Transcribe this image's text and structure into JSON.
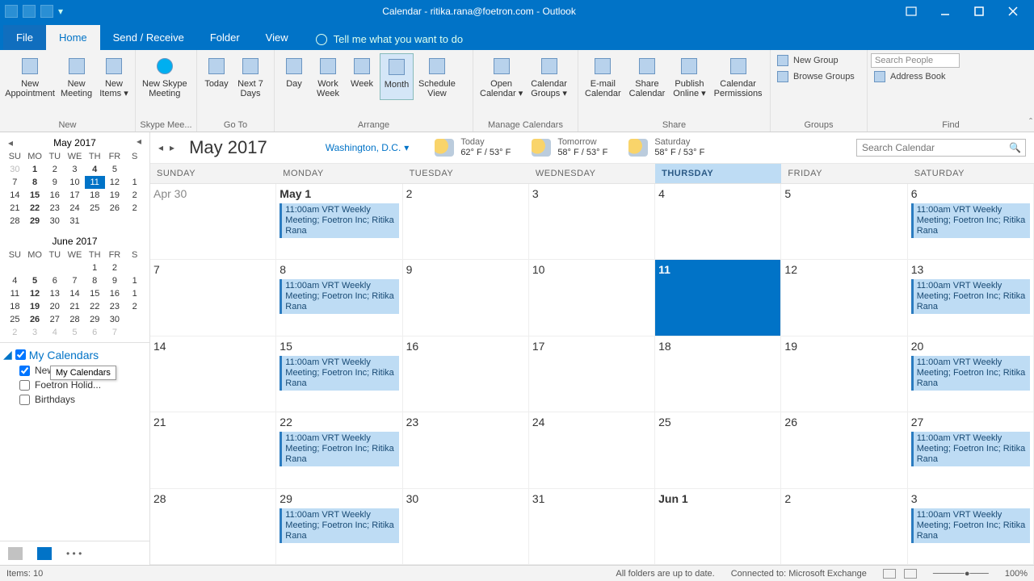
{
  "title": "Calendar - ritika.rana@foetron.com - Outlook",
  "tabs": {
    "file": "File",
    "home": "Home",
    "sendrecv": "Send / Receive",
    "folder": "Folder",
    "view": "View"
  },
  "tellme": "Tell me what you want to do",
  "ribbon": {
    "new": {
      "label": "New",
      "appointment": "New\nAppointment",
      "meeting": "New\nMeeting",
      "items": "New\nItems ▾"
    },
    "skype": {
      "label": "Skype Mee...",
      "btn": "New Skype\nMeeting"
    },
    "goto": {
      "label": "Go To",
      "today": "Today",
      "next7": "Next 7\nDays"
    },
    "arrange": {
      "label": "Arrange",
      "day": "Day",
      "workweek": "Work\nWeek",
      "week": "Week",
      "month": "Month",
      "schedule": "Schedule\nView"
    },
    "manage": {
      "label": "Manage Calendars",
      "open": "Open\nCalendar ▾",
      "groups": "Calendar\nGroups ▾"
    },
    "share": {
      "label": "Share",
      "email": "E-mail\nCalendar",
      "sharecal": "Share\nCalendar",
      "publish": "Publish\nOnline ▾",
      "perms": "Calendar\nPermissions"
    },
    "groups": {
      "label": "Groups",
      "newgroup": "New Group",
      "browse": "Browse Groups"
    },
    "find": {
      "label": "Find",
      "searchph": "Search People",
      "addrbook": "Address Book"
    }
  },
  "minical1": {
    "title": "May 2017",
    "dh": [
      "SU",
      "MO",
      "TU",
      "WE",
      "TH",
      "FR",
      "S"
    ],
    "rows": [
      [
        {
          "n": "30",
          "dim": 1
        },
        {
          "n": "1",
          "b": 1
        },
        {
          "n": "2"
        },
        {
          "n": "3"
        },
        {
          "n": "4",
          "b": 1
        },
        {
          "n": "5"
        },
        {
          "n": ""
        }
      ],
      [
        {
          "n": "7"
        },
        {
          "n": "8",
          "b": 1
        },
        {
          "n": "9"
        },
        {
          "n": "10"
        },
        {
          "n": "11",
          "t": 1
        },
        {
          "n": "12"
        },
        {
          "n": "1"
        }
      ],
      [
        {
          "n": "14"
        },
        {
          "n": "15",
          "b": 1
        },
        {
          "n": "16"
        },
        {
          "n": "17"
        },
        {
          "n": "18"
        },
        {
          "n": "19"
        },
        {
          "n": "2"
        }
      ],
      [
        {
          "n": "21"
        },
        {
          "n": "22",
          "b": 1
        },
        {
          "n": "23"
        },
        {
          "n": "24"
        },
        {
          "n": "25"
        },
        {
          "n": "26"
        },
        {
          "n": "2"
        }
      ],
      [
        {
          "n": "28"
        },
        {
          "n": "29",
          "b": 1
        },
        {
          "n": "30"
        },
        {
          "n": "31"
        },
        {
          "n": ""
        },
        {
          "n": ""
        },
        {
          "n": ""
        }
      ]
    ]
  },
  "minical2": {
    "title": "June 2017",
    "dh": [
      "SU",
      "MO",
      "TU",
      "WE",
      "TH",
      "FR",
      "S"
    ],
    "rows": [
      [
        {
          "n": ""
        },
        {
          "n": ""
        },
        {
          "n": ""
        },
        {
          "n": ""
        },
        {
          "n": "1"
        },
        {
          "n": "2"
        },
        {
          "n": ""
        }
      ],
      [
        {
          "n": "4"
        },
        {
          "n": "5",
          "b": 1
        },
        {
          "n": "6"
        },
        {
          "n": "7"
        },
        {
          "n": "8"
        },
        {
          "n": "9"
        },
        {
          "n": "1"
        }
      ],
      [
        {
          "n": "11"
        },
        {
          "n": "12",
          "b": 1
        },
        {
          "n": "13"
        },
        {
          "n": "14"
        },
        {
          "n": "15"
        },
        {
          "n": "16"
        },
        {
          "n": "1"
        }
      ],
      [
        {
          "n": "18"
        },
        {
          "n": "19",
          "b": 1
        },
        {
          "n": "20"
        },
        {
          "n": "21"
        },
        {
          "n": "22"
        },
        {
          "n": "23"
        },
        {
          "n": "2"
        }
      ],
      [
        {
          "n": "25"
        },
        {
          "n": "26",
          "b": 1
        },
        {
          "n": "27"
        },
        {
          "n": "28"
        },
        {
          "n": "29"
        },
        {
          "n": "30"
        },
        {
          "n": ""
        }
      ],
      [
        {
          "n": "2",
          "dim": 1
        },
        {
          "n": "3",
          "dim": 1
        },
        {
          "n": "4",
          "dim": 1
        },
        {
          "n": "5",
          "dim": 1
        },
        {
          "n": "6",
          "dim": 1
        },
        {
          "n": "7",
          "dim": 1
        },
        {
          "n": ""
        }
      ]
    ]
  },
  "calendars": {
    "header": "My Calendars",
    "tooltip": "My Calendars",
    "items": [
      {
        "label": "New",
        "checked": true
      },
      {
        "label": "Foetron Holid...",
        "checked": false
      },
      {
        "label": "Birthdays",
        "checked": false
      }
    ]
  },
  "mainhead": {
    "title": "May 2017",
    "location": "Washington, D.C.",
    "wx": [
      {
        "label": "Today",
        "temp": "62° F / 53° F"
      },
      {
        "label": "Tomorrow",
        "temp": "58° F / 53° F"
      },
      {
        "label": "Saturday",
        "temp": "58° F / 53° F"
      }
    ],
    "searchph": "Search Calendar"
  },
  "dayheaders": [
    "SUNDAY",
    "MONDAY",
    "TUESDAY",
    "WEDNESDAY",
    "THURSDAY",
    "FRIDAY",
    "SATURDAY"
  ],
  "todayIndex": 4,
  "eventText": "11:00am VRT Weekly Meeting; Foetron Inc; Ritika Rana",
  "weeks": [
    [
      {
        "d": "Apr 30",
        "other": 1
      },
      {
        "d": "May 1",
        "bold": 1,
        "e": 1
      },
      {
        "d": "2"
      },
      {
        "d": "3"
      },
      {
        "d": "4"
      },
      {
        "d": "5"
      },
      {
        "d": "6",
        "e": 1
      }
    ],
    [
      {
        "d": "7"
      },
      {
        "d": "8",
        "e": 1
      },
      {
        "d": "9"
      },
      {
        "d": "10"
      },
      {
        "d": "11",
        "today": 1
      },
      {
        "d": "12"
      },
      {
        "d": "13",
        "e": 1
      }
    ],
    [
      {
        "d": "14"
      },
      {
        "d": "15",
        "e": 1
      },
      {
        "d": "16"
      },
      {
        "d": "17"
      },
      {
        "d": "18"
      },
      {
        "d": "19"
      },
      {
        "d": "20",
        "e": 1
      }
    ],
    [
      {
        "d": "21"
      },
      {
        "d": "22",
        "e": 1
      },
      {
        "d": "23"
      },
      {
        "d": "24"
      },
      {
        "d": "25"
      },
      {
        "d": "26"
      },
      {
        "d": "27",
        "e": 1
      }
    ],
    [
      {
        "d": "28"
      },
      {
        "d": "29",
        "e": 1
      },
      {
        "d": "30"
      },
      {
        "d": "31"
      },
      {
        "d": "Jun 1",
        "bold": 1
      },
      {
        "d": "2"
      },
      {
        "d": "3",
        "e": 1
      }
    ]
  ],
  "status": {
    "items": "Items: 10",
    "folders": "All folders are up to date.",
    "connected": "Connected to: Microsoft Exchange",
    "zoom": "100%"
  }
}
